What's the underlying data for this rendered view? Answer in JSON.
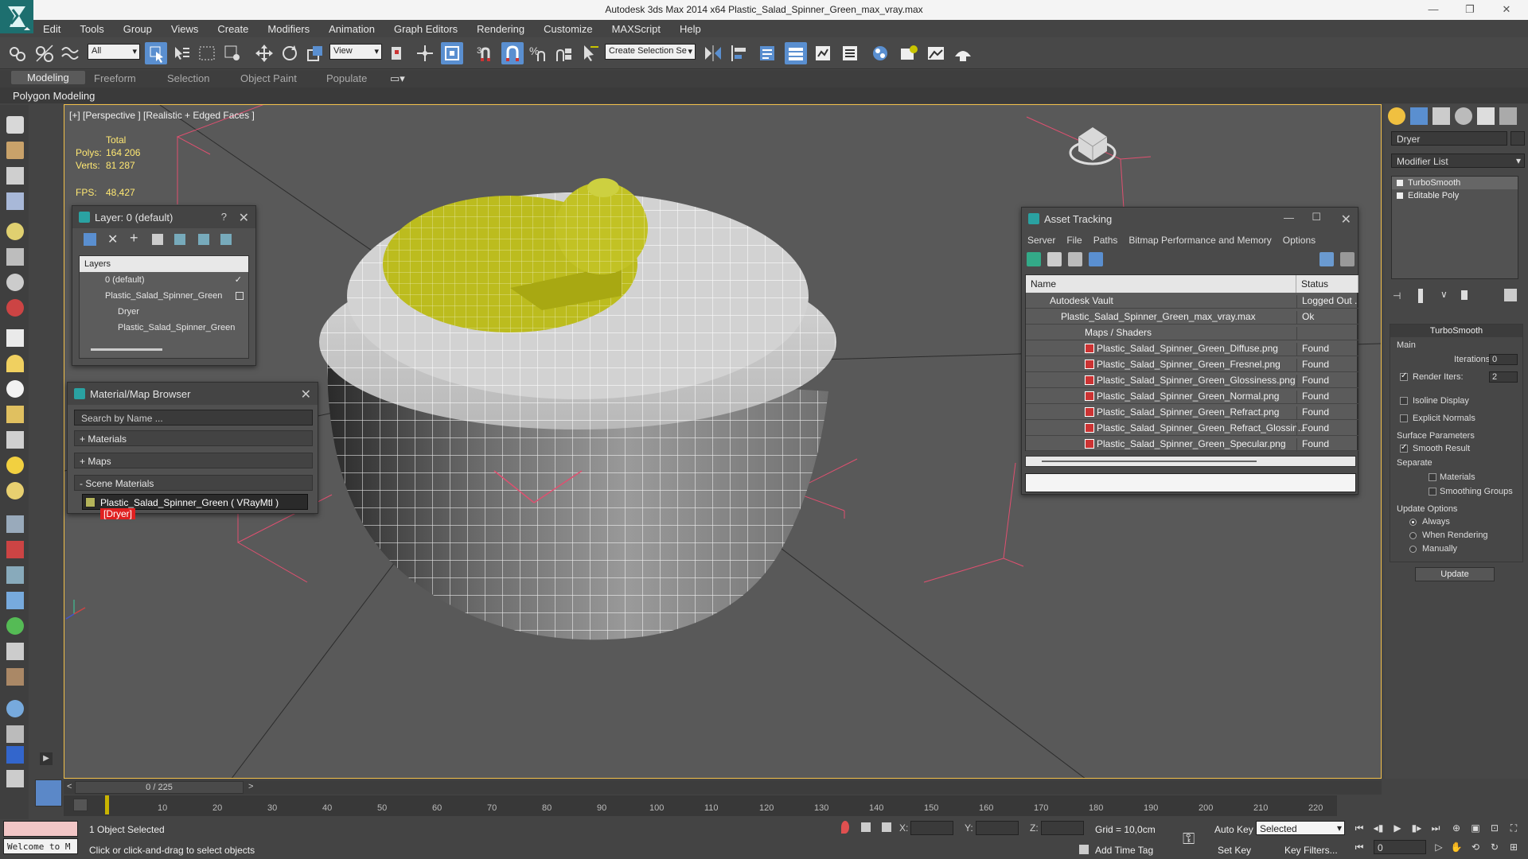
{
  "title_bar": {
    "title": "Autodesk 3ds Max  2014 x64    Plastic_Salad_Spinner_Green_max_vray.max"
  },
  "menu": [
    "Edit",
    "Tools",
    "Group",
    "Views",
    "Create",
    "Modifiers",
    "Animation",
    "Graph Editors",
    "Rendering",
    "Customize",
    "MAXScript",
    "Help"
  ],
  "toolbar": {
    "selection_filter": "All",
    "reference_coord": "View",
    "named_selection": "Create Selection Se"
  },
  "ribbon": {
    "tabs": [
      "Modeling",
      "Freeform",
      "Selection",
      "Object Paint",
      "Populate"
    ],
    "sub_label": "Polygon Modeling"
  },
  "viewport": {
    "label": "[+] [Perspective ] [Realistic + Edged Faces ]",
    "stats": {
      "total_label": "Total",
      "polys_label": "Polys:",
      "polys_value": "164 206",
      "verts_label": "Verts:",
      "verts_value": "81 287",
      "fps_label": "FPS:",
      "fps_value": "48,427"
    }
  },
  "layer_panel": {
    "title": "Layer: 0 (default)",
    "help": "?",
    "header": "Layers",
    "rows": [
      "0 (default)",
      "Plastic_Salad_Spinner_Green",
      "Dryer",
      "Plastic_Salad_Spinner_Green"
    ]
  },
  "material_browser": {
    "title": "Material/Map Browser",
    "search_placeholder": "Search by Name ...",
    "groups": [
      "+ Materials",
      "+ Maps",
      "- Scene Materials"
    ],
    "item_name": "Plastic_Salad_Spinner_Green  ( VRayMtl )",
    "item_tag": "[Dryer]"
  },
  "asset_tracking": {
    "title": "Asset Tracking",
    "menu": [
      "Server",
      "File",
      "Paths",
      "Bitmap Performance and Memory",
      "Options"
    ],
    "columns": [
      "Name",
      "Status"
    ],
    "rows": [
      {
        "name": "Autodesk Vault",
        "status": "Logged Out ..."
      },
      {
        "name": "Plastic_Salad_Spinner_Green_max_vray.max",
        "status": "Ok"
      },
      {
        "name": "Maps / Shaders",
        "status": ""
      },
      {
        "name": "Plastic_Salad_Spinner_Green_Diffuse.png",
        "status": "Found"
      },
      {
        "name": "Plastic_Salad_Spinner_Green_Fresnel.png",
        "status": "Found"
      },
      {
        "name": "Plastic_Salad_Spinner_Green_Glossiness.png",
        "status": "Found"
      },
      {
        "name": "Plastic_Salad_Spinner_Green_Normal.png",
        "status": "Found"
      },
      {
        "name": "Plastic_Salad_Spinner_Green_Refract.png",
        "status": "Found"
      },
      {
        "name": "Plastic_Salad_Spinner_Green_Refract_Glossin...",
        "status": "Found"
      },
      {
        "name": "Plastic_Salad_Spinner_Green_Specular.png",
        "status": "Found"
      }
    ]
  },
  "command_panel": {
    "object_name": "Dryer",
    "modifier_list": "Modifier List",
    "stack": [
      "TurboSmooth",
      "Editable Poly"
    ],
    "turbosmooth": {
      "title": "TurboSmooth",
      "main_label": "Main",
      "iterations_label": "Iterations:",
      "iterations_value": "0",
      "render_iters_label": "Render Iters:",
      "render_iters_value": "2",
      "isoline_label": "Isoline Display",
      "explicit_normals_label": "Explicit Normals",
      "surface_params_label": "Surface Parameters",
      "smooth_result_label": "Smooth Result",
      "separate_label": "Separate",
      "materials_label": "Materials",
      "smoothing_groups_label": "Smoothing Groups",
      "update_options_label": "Update Options",
      "always_label": "Always",
      "when_rendering_label": "When Rendering",
      "manually_label": "Manually",
      "update_button": "Update"
    }
  },
  "timeline": {
    "slider_label": "0 / 225",
    "ticks": [
      "10",
      "20",
      "30",
      "40",
      "50",
      "60",
      "70",
      "80",
      "90",
      "100",
      "110",
      "120",
      "130",
      "140",
      "150",
      "160",
      "170",
      "180",
      "190",
      "200",
      "210",
      "220"
    ]
  },
  "status": {
    "selection": "1 Object Selected",
    "prompt": "Click or click-and-drag to select objects",
    "welcome": "Welcome to M",
    "x_label": "X:",
    "y_label": "Y:",
    "z_label": "Z:",
    "grid": "Grid = 10,0cm",
    "add_time_tag": "Add Time Tag",
    "auto_key": "Auto Key",
    "set_key": "Set Key",
    "key_mode": "Selected",
    "key_filters": "Key Filters...",
    "frame": "0"
  },
  "colors": {
    "accent_yellow": "#c8c400",
    "viewport_bg": "#595959",
    "viewport_border": "#f2c04a",
    "tag_red": "#e02020"
  }
}
